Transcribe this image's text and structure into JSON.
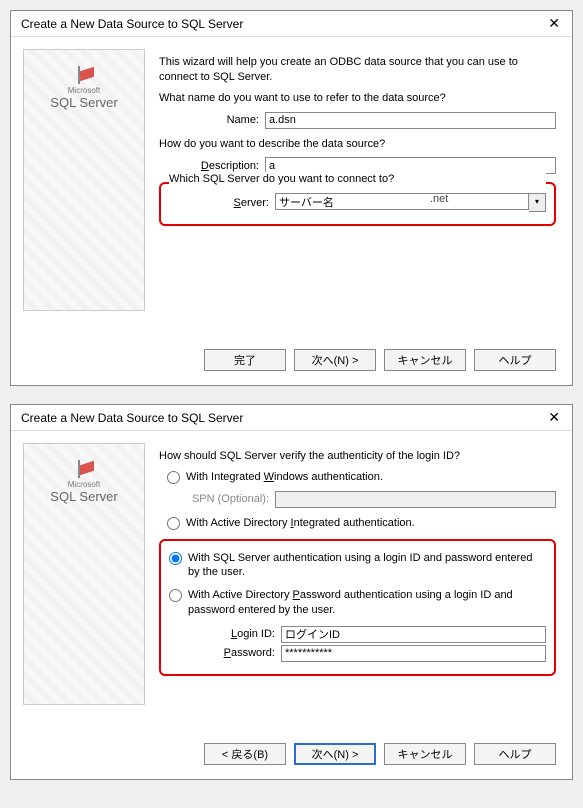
{
  "wizard1": {
    "title": "Create a New Data Source to SQL Server",
    "close_glyph": "✕",
    "brand_small": "Microsoft",
    "brand_big": "SQL Server",
    "intro": "This wizard will help you create an ODBC data source that you can use to connect to SQL Server.",
    "q_name": "What name do you want to use to refer to the data source?",
    "label_name": "Name:",
    "value_name": "a.dsn",
    "q_desc": "How do you want to describe the data source?",
    "label_desc_pre": "D",
    "label_desc_post": "escription:",
    "value_desc": "a",
    "q_server": "Which SQL Server do you want to connect to?",
    "label_server_pre": "S",
    "label_server_post": "erver:",
    "value_server": "サーバー名",
    "server_suffix": ".net",
    "btn_finish": "完了",
    "btn_next": "次へ(N) >",
    "btn_cancel": "キャンセル",
    "btn_help": "ヘルプ"
  },
  "wizard2": {
    "title": "Create a New Data Source to SQL Server",
    "close_glyph": "✕",
    "brand_small": "Microsoft",
    "brand_big": "SQL Server",
    "q_auth": "How should SQL Server verify the authenticity of the login ID?",
    "opt_win_pre": "With Integrated ",
    "opt_win_u": "W",
    "opt_win_post": "indows authentication.",
    "label_spn": "SPN (Optional):",
    "opt_adi_pre": "With Active Directory ",
    "opt_adi_u": "I",
    "opt_adi_post": "ntegrated authentication.",
    "opt_sql": "With SQL Server authentication using a login ID and password entered by the user.",
    "opt_adp_pre": "With Active Directory ",
    "opt_adp_u": "P",
    "opt_adp_post": "assword authentication using a login ID and password entered by the user.",
    "label_login_pre": "L",
    "label_login_post": "ogin ID:",
    "value_login": "ログインID",
    "label_pw_pre": "P",
    "label_pw_post": "assword:",
    "value_pw": "***********",
    "btn_back": "< 戻る(B)",
    "btn_next": "次へ(N) >",
    "btn_cancel": "キャンセル",
    "btn_help": "ヘルプ"
  }
}
